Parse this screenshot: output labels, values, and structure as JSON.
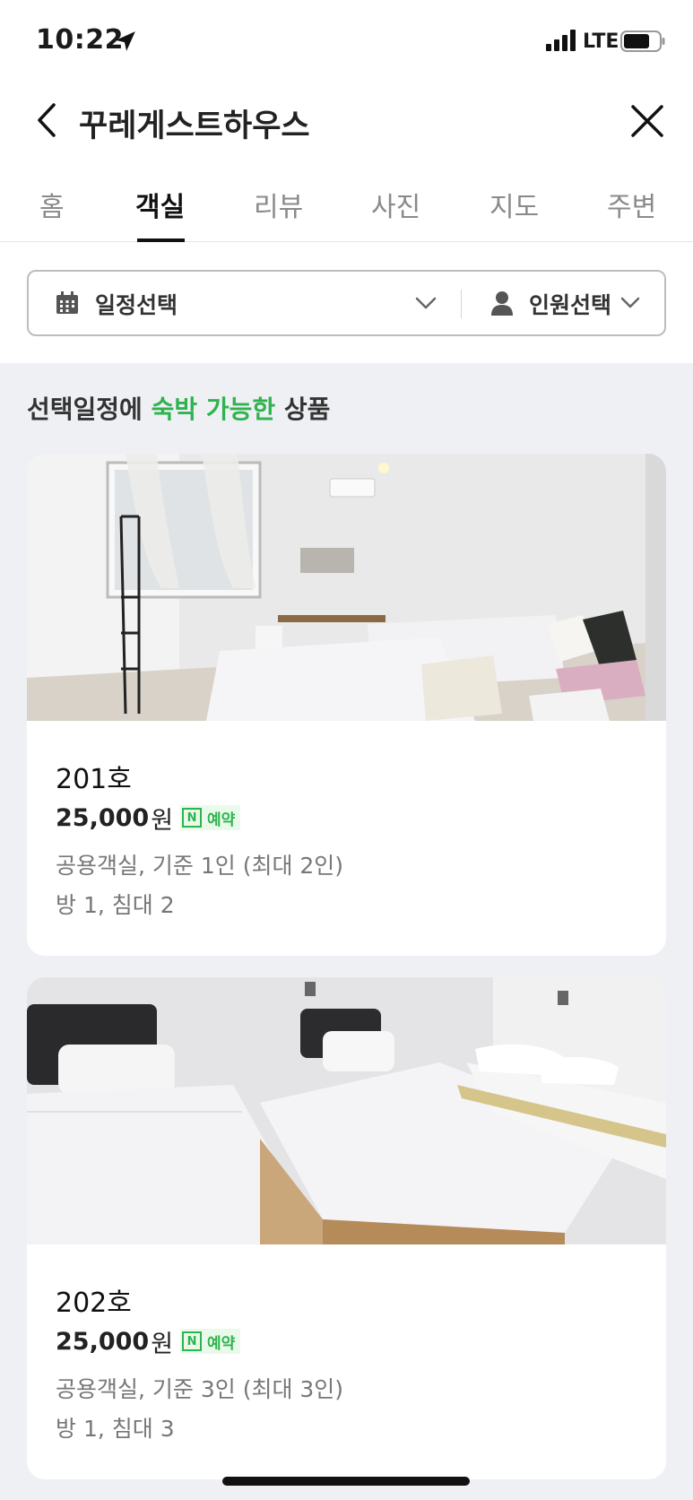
{
  "status_bar": {
    "time": "10:22",
    "network": "LTE"
  },
  "header": {
    "title": "꾸레게스트하우스"
  },
  "tabs": [
    "홈",
    "객실",
    "리뷰",
    "사진",
    "지도",
    "주변"
  ],
  "active_tab": "객실",
  "filter": {
    "date_label": "일정선택",
    "people_label": "인원선택"
  },
  "section": {
    "prefix": "선택일정에 ",
    "highlight": "숙박 가능한",
    "suffix": " 상품"
  },
  "rooms": [
    {
      "name": "201호",
      "price": "25,000",
      "unit": "원",
      "badge": "예약",
      "desc": "공용객실, 기준 1인 (최대 2인)",
      "beds": "방 1, 침대 2"
    },
    {
      "name": "202호",
      "price": "25,000",
      "unit": "원",
      "badge": "예약",
      "desc": "공용객실, 기준 3인 (최대 3인)",
      "beds": "방 1, 침대 3"
    }
  ],
  "colors": {
    "accent": "#2fb34f",
    "background": "#eef0f3"
  }
}
